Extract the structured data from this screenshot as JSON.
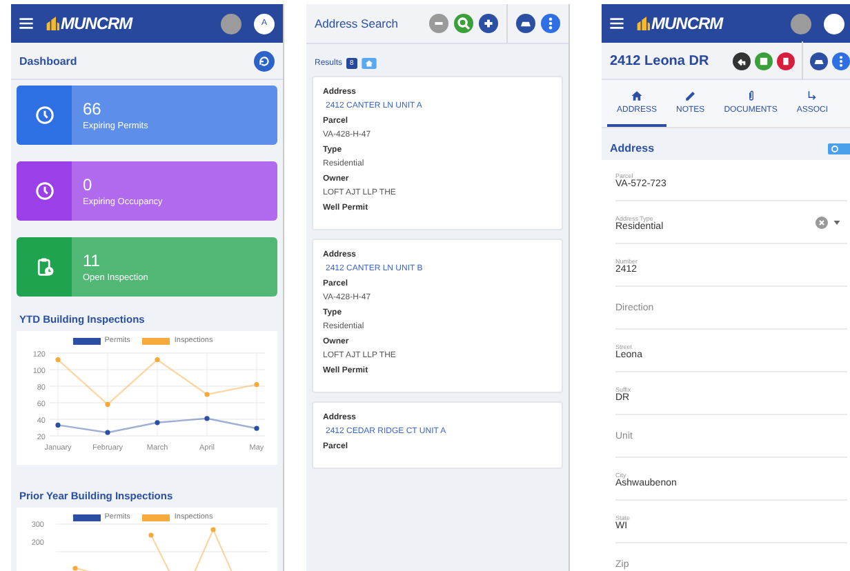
{
  "dashboard": {
    "logo": "MUNCRM",
    "avatar": "A",
    "title": "Dashboard",
    "stats": [
      {
        "value": "66",
        "label": "Expiring Permits",
        "color": "#2f6fe4",
        "kind": "clock"
      },
      {
        "value": "0",
        "label": "Expiring Occupancy",
        "color": "#9b3fe8",
        "kind": "clock"
      },
      {
        "value": "11",
        "label": "Open Inspection",
        "color": "#1fa34e",
        "kind": "clipboard"
      }
    ],
    "ytd": {
      "title": "YTD Building Inspections",
      "chart_data": {
        "type": "line",
        "categories": [
          "January",
          "February",
          "March",
          "April",
          "May"
        ],
        "series": [
          {
            "name": "Permits",
            "color": "#2b4fa3",
            "marker": true,
            "values": [
              33,
              24,
              36,
              41,
              29
            ]
          },
          {
            "name": "Inspections",
            "color": "#f7a93b",
            "marker": true,
            "values": [
              112,
              58,
              112,
              70,
              82
            ]
          }
        ],
        "grid": true,
        "ylim": [
          20,
          120
        ],
        "yticks": [
          20,
          40,
          60,
          80,
          100,
          120
        ]
      }
    },
    "prior": {
      "title": "Prior Year Building Inspections",
      "legend": [
        "Permits",
        "Inspections"
      ],
      "tick_labels": [
        "300",
        "200"
      ]
    }
  },
  "search": {
    "title": "Address Search",
    "results_label": "Results",
    "results_count": "8",
    "results": [
      {
        "fields": [
          {
            "label": "Address",
            "value": "2412 CANTER LN UNIT A",
            "kind": "link"
          },
          {
            "label": "Parcel",
            "value": "VA-428-H-47",
            "kind": "text"
          },
          {
            "label": "Type",
            "value": "Residential",
            "kind": "text"
          },
          {
            "label": "Owner",
            "value": "LOFT AJT LLP THE",
            "kind": "text"
          },
          {
            "label": "Well Permit"
          }
        ]
      },
      {
        "fields": [
          {
            "label": "Address",
            "value": "2412 CANTER LN UNIT B",
            "kind": "link"
          },
          {
            "label": "Parcel",
            "value": "VA-428-H-47",
            "kind": "text"
          },
          {
            "label": "Type",
            "value": "Residential",
            "kind": "text"
          },
          {
            "label": "Owner",
            "value": "LOFT AJT LLP THE",
            "kind": "text"
          },
          {
            "label": "Well Permit"
          }
        ]
      },
      {
        "fields": [
          {
            "label": "Address",
            "value": "2412 CEDAR RIDGE CT UNIT A",
            "kind": "link"
          },
          {
            "label": "Parcel"
          }
        ]
      }
    ]
  },
  "record": {
    "logo": "MUNCRM",
    "title": "2412 Leona DR",
    "tabs": [
      {
        "label": "ADDRESS",
        "kind": "home",
        "selected": true
      },
      {
        "label": "NOTES",
        "kind": "pencil",
        "selected": false
      },
      {
        "label": "DOCUMENTS",
        "kind": "clip",
        "selected": false
      },
      {
        "label": "ASSOCI",
        "kind": "link",
        "selected": false
      }
    ],
    "section": "Address",
    "fields": [
      {
        "label": "Parcel",
        "value": "VA-572-723",
        "kind": "text"
      },
      {
        "label": "Address Type",
        "value": "Residential",
        "kind": "select"
      },
      {
        "label": "Number",
        "value": "2412",
        "kind": "text"
      },
      {
        "label": "Direction",
        "kind": "text"
      },
      {
        "label": "Street",
        "value": "Leona",
        "kind": "text"
      },
      {
        "label": "Suffix",
        "value": "DR",
        "kind": "text"
      },
      {
        "label": "Unit",
        "kind": "text"
      },
      {
        "label": "City",
        "value": "Ashwaubenon",
        "kind": "text"
      },
      {
        "label": "State",
        "value": "WI",
        "kind": "text"
      },
      {
        "label": "Zip",
        "kind": "text"
      }
    ]
  }
}
